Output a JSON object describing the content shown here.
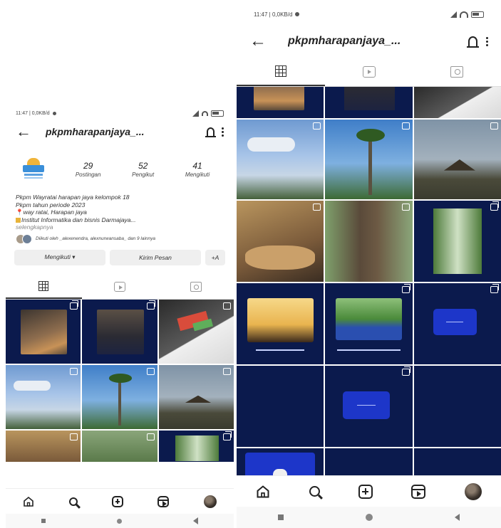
{
  "left_screen": {
    "status_time": "11:47 | 0,0KB/d",
    "username": "pkpmharapanjaya_...",
    "stats": [
      {
        "value": "29",
        "label": "Postingan"
      },
      {
        "value": "52",
        "label": "Pengikut"
      },
      {
        "value": "41",
        "label": "Mengikuti"
      }
    ],
    "bio_line_1": "Pkpm Wayratai harapan jaya kelompok 18",
    "bio_line_2": "Pkpm tahun periode 2023",
    "bio_line_3": "way ratai, Harapan jaya",
    "bio_line_4": "Institut Informatika dan bisnis Darmajaya...",
    "bio_more": "selengkapnya",
    "followed_by": "Diikuti oleh _alexenendra, alexnurwansaba_ dan 9 lainnya",
    "follow_button": "Mengikuti ▾",
    "message_button": "Kirim Pesan",
    "add_user_button": "+A"
  },
  "right_screen": {
    "status_time": "11:47 | 0,0KB/d",
    "username": "pkpmharapanjaya_..."
  },
  "colors": {
    "navy": "#0b1a4d",
    "accent_blue": "#1d36c9"
  }
}
